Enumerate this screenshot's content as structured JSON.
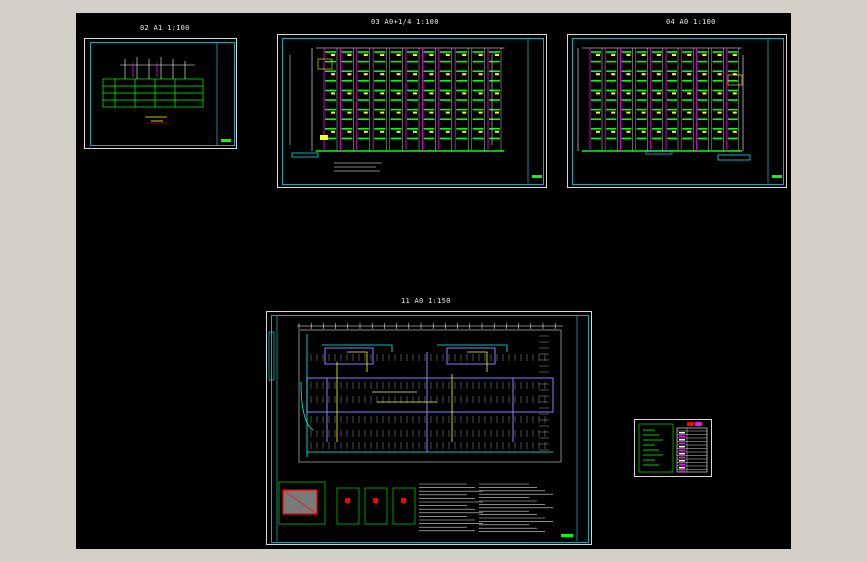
{
  "sheets": [
    {
      "id": "02",
      "title": "02 A1 1:100"
    },
    {
      "id": "03",
      "title": "03 A0+1/4 1:100"
    },
    {
      "id": "04",
      "title": "04 A0 1:100"
    },
    {
      "id": "11",
      "title": "11 A0 1:150"
    }
  ],
  "colors": {
    "background": "#000000",
    "frame": "#d8d8d8",
    "border": "#1aa8b8",
    "green": "#00ff00",
    "magenta": "#ff00ff",
    "yellow": "#ffff00",
    "cyan": "#00ffff",
    "red": "#ff0000",
    "purple": "#8a7cff",
    "gray": "#a0a0a0"
  },
  "icons": {
    "legend": "legend-table-icon"
  }
}
